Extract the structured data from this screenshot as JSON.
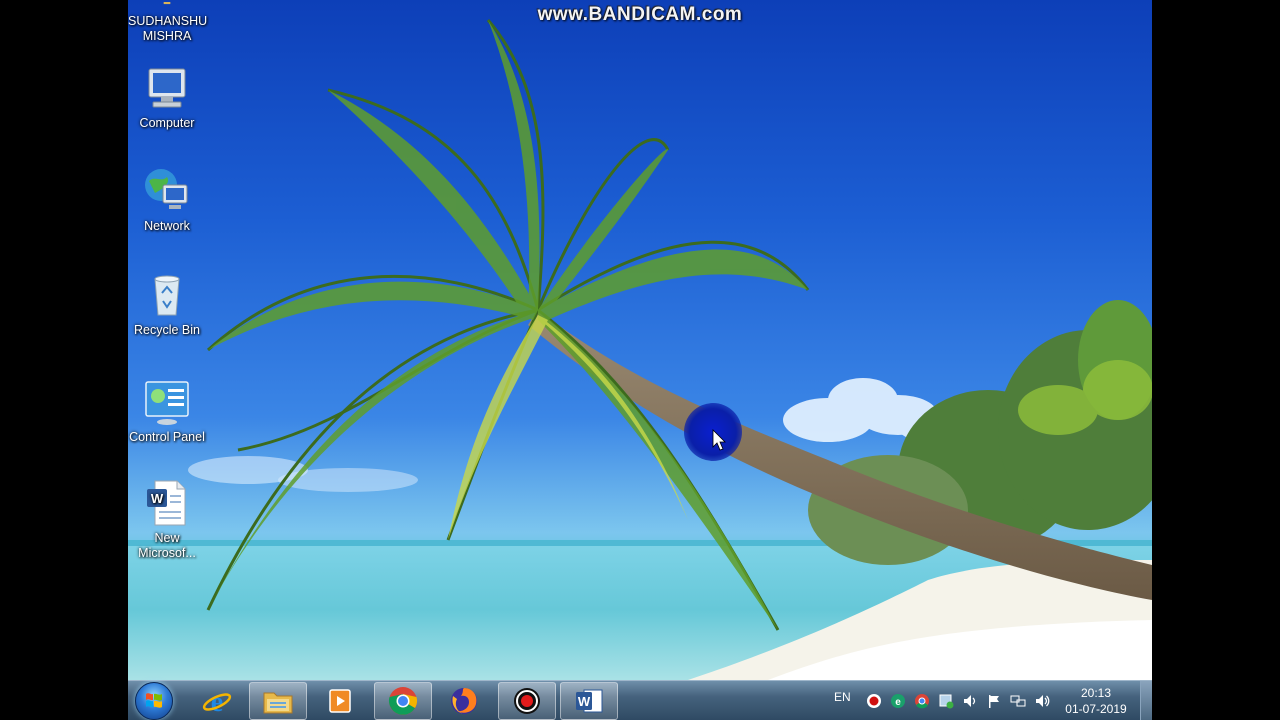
{
  "watermark": "www.BANDICAM.com",
  "desktop": {
    "icons": [
      {
        "label_line1": "SUDHANSHU",
        "label_line2": "MISHRA",
        "icon": "user-folder-icon"
      },
      {
        "label_line1": "Computer",
        "label_line2": "",
        "icon": "computer-icon"
      },
      {
        "label_line1": "Network",
        "label_line2": "",
        "icon": "network-icon"
      },
      {
        "label_line1": "Recycle Bin",
        "label_line2": "",
        "icon": "recycle-bin-icon"
      },
      {
        "label_line1": "Control Panel",
        "label_line2": "",
        "icon": "control-panel-icon"
      },
      {
        "label_line1": "New",
        "label_line2": "Microsof...",
        "icon": "word-document-icon"
      }
    ]
  },
  "taskbar": {
    "start": "start-orb-icon",
    "pinned": [
      {
        "icon": "internet-explorer-icon"
      },
      {
        "icon": "file-explorer-icon"
      },
      {
        "icon": "media-player-icon"
      },
      {
        "icon": "chrome-icon"
      },
      {
        "icon": "firefox-icon"
      },
      {
        "icon": "bandicam-icon"
      },
      {
        "icon": "word-icon"
      }
    ],
    "tray": {
      "language": "EN",
      "time": "20:13",
      "date": "01-07-2019"
    }
  },
  "colors": {
    "taskbar": "#3b5875",
    "sky": "#1c5ed3",
    "cursor_highlight": "#0a1fa8"
  }
}
